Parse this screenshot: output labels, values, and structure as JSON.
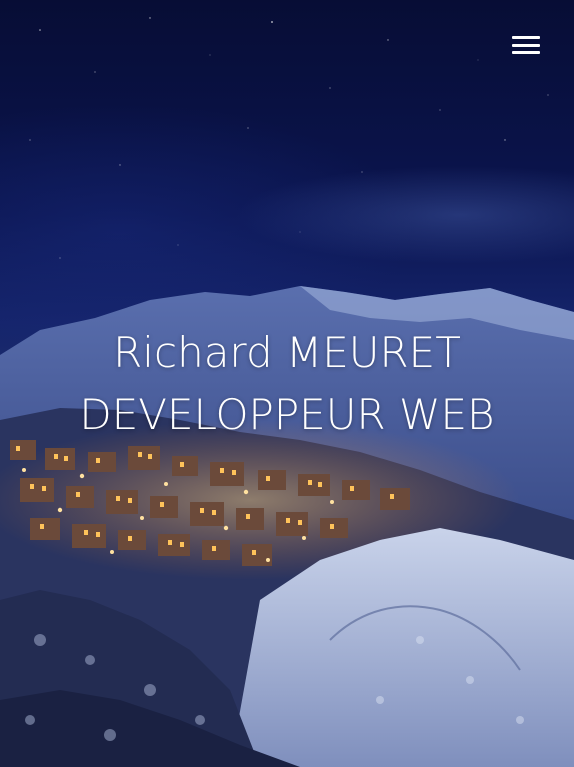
{
  "header": {
    "menu_icon": "hamburger-menu-icon"
  },
  "hero": {
    "name": "Richard MEURET",
    "role": "DEVELOPPEUR WEB",
    "background_image": "night-mountain-village-snow"
  },
  "colors": {
    "text": "#ffffff",
    "sky_top": "#070d35",
    "sky_mid": "#15246b",
    "village_lights": "#ffb347"
  }
}
